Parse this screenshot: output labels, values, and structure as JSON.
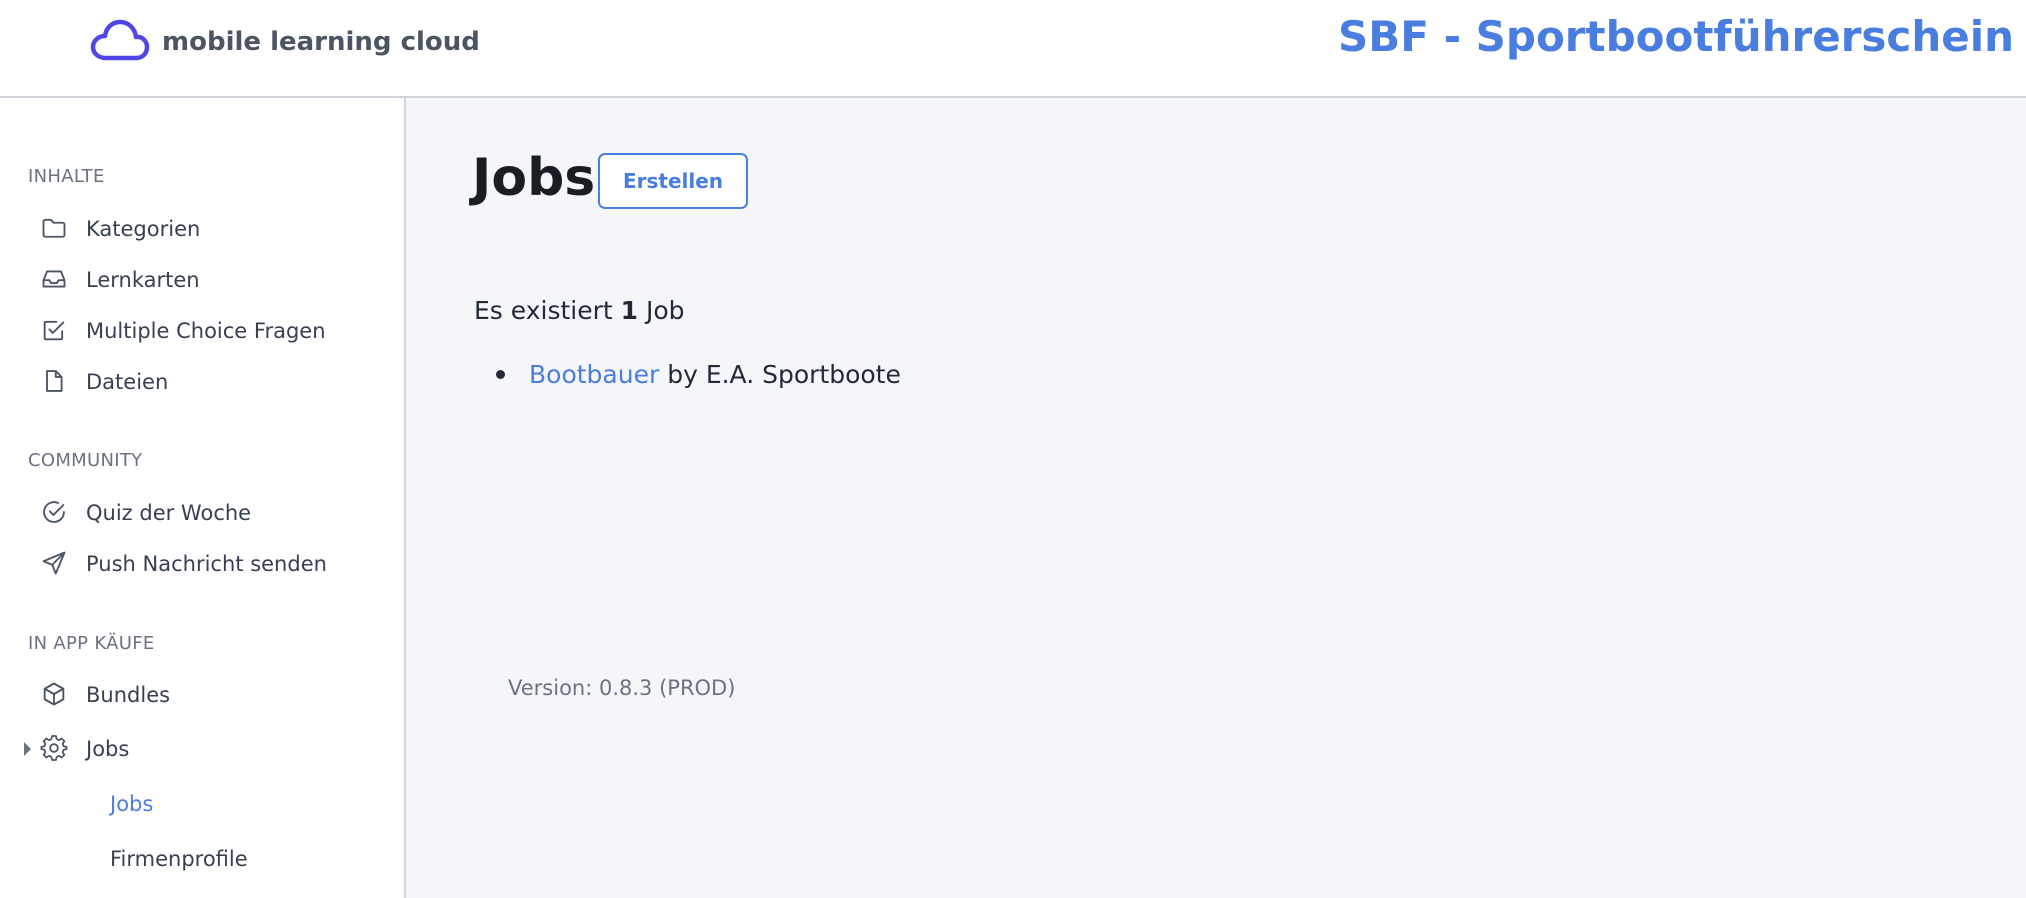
{
  "header": {
    "logo_text": "mobile learning cloud",
    "app_title": "SBF - Sportbootführerschein",
    "brand_color": "#4f46e5",
    "accent_color": "#4a7de0"
  },
  "sidebar": {
    "sections": [
      {
        "title": "INHALTE",
        "items": [
          {
            "label": "Kategorien",
            "icon": "folder-icon"
          },
          {
            "label": "Lernkarten",
            "icon": "inbox-icon"
          },
          {
            "label": "Multiple Choice Fragen",
            "icon": "checkbox-icon"
          },
          {
            "label": "Dateien",
            "icon": "file-icon"
          }
        ]
      },
      {
        "title": "COMMUNITY",
        "items": [
          {
            "label": "Quiz der Woche",
            "icon": "check-circle-icon"
          },
          {
            "label": "Push Nachricht senden",
            "icon": "send-icon"
          }
        ]
      },
      {
        "title": "IN APP KÄUFE",
        "items": [
          {
            "label": "Bundles",
            "icon": "cube-icon"
          },
          {
            "label": "Jobs",
            "icon": "gear-icon",
            "expanded": true,
            "children": [
              {
                "label": "Jobs",
                "active": true
              },
              {
                "label": "Firmenprofile",
                "active": false
              }
            ]
          }
        ]
      }
    ]
  },
  "main": {
    "title": "Jobs",
    "create_label": "Erstellen",
    "count_prefix": "Es existiert",
    "count": "1",
    "count_suffix": "Job",
    "jobs": [
      {
        "title": "Bootbauer",
        "by": "by E.A. Sportboote"
      }
    ],
    "version": "Version: 0.8.3 (PROD)"
  }
}
